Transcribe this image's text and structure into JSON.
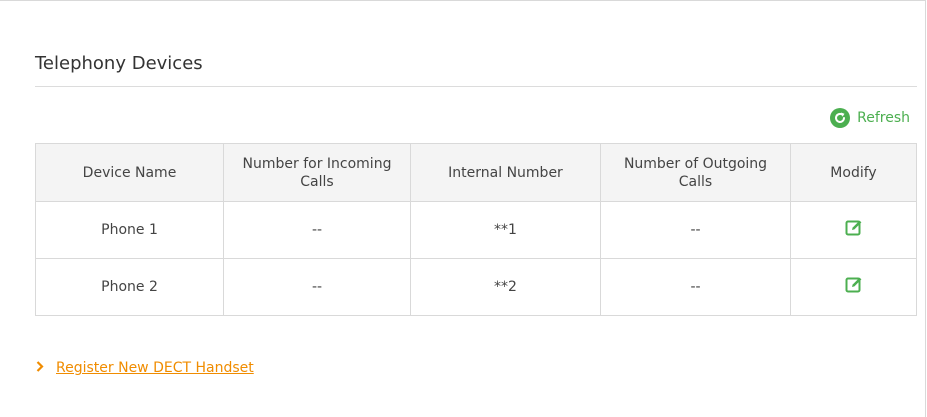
{
  "section": {
    "title": "Telephony Devices"
  },
  "toolbar": {
    "refresh_label": "Refresh",
    "refresh_icon": "refresh-icon"
  },
  "table": {
    "columns": [
      "Device Name",
      "Number for Incoming Calls",
      "Internal Number",
      "Number of Outgoing Calls",
      "Modify"
    ],
    "rows": [
      {
        "device_name": "Phone 1",
        "incoming": "--",
        "internal": "**1",
        "outgoing": "--",
        "modify_icon": "edit-icon"
      },
      {
        "device_name": "Phone 2",
        "incoming": "--",
        "internal": "**2",
        "outgoing": "--",
        "modify_icon": "edit-icon"
      }
    ]
  },
  "footer": {
    "register_link": "Register New DECT Handset",
    "chevron_icon": "chevron-right-icon"
  },
  "colors": {
    "accent_green": "#4caf50",
    "link_orange": "#f08c00",
    "header_bg": "#f4f4f4",
    "border": "#d9d9d9"
  }
}
